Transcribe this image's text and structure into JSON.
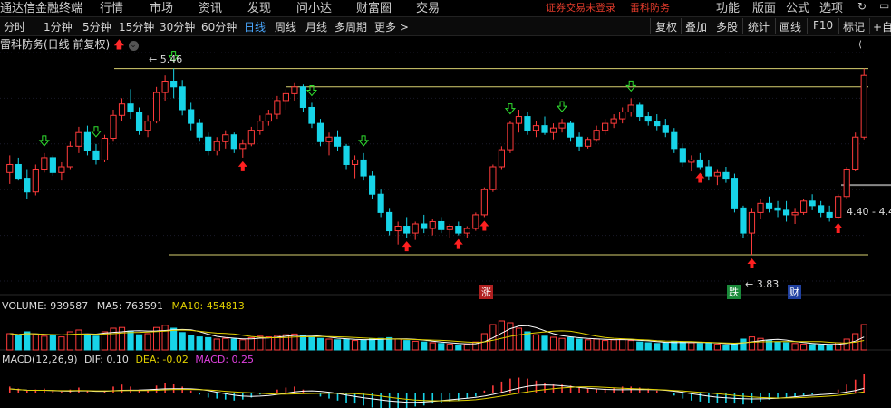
{
  "menubar": {
    "app_title": "通达信金融终端",
    "menus": [
      "行情",
      "市场",
      "资讯",
      "发现",
      "问小达",
      "财富圈",
      "交易"
    ],
    "alert": "证券交易未登录",
    "stock_link": "雷科防务",
    "right_menus": [
      "功能",
      "版面",
      "公式",
      "选项"
    ]
  },
  "timeframes": [
    "分时",
    "1分钟",
    "5分钟",
    "15分钟",
    "30分钟",
    "60分钟",
    "日线",
    "周线",
    "月线",
    "多周期",
    "更多 >"
  ],
  "active_timeframe": "日线",
  "tools": [
    "复权",
    "叠加",
    "多股",
    "统计",
    "画线",
    "F10",
    "标记",
    "+自"
  ],
  "chart_title": "雷科防务(日线 前复权)",
  "labels": {
    "high": "5.46",
    "low": "3.83",
    "range": "4.40 - 4.4",
    "zhang": "涨",
    "die": "跌",
    "cai": "财"
  },
  "volume": {
    "name": "VOLUME: 939587",
    "ma5": "MA5: 763591",
    "ma10": "MA10: 454813"
  },
  "macd": {
    "name": "MACD(12,26,9)",
    "dif": "DIF: 0.10",
    "dea": "DEA: -0.02",
    "macd": "MACD: 0.25"
  },
  "colors": {
    "up": "#ff3b3b",
    "down": "#17d4e8",
    "ma5": "#ffffff",
    "ma10": "#e0d000",
    "macd_text": "#e040e0",
    "active": "#4aa8ff"
  },
  "chart_data": [
    {
      "type": "candlestick",
      "title": "雷科防务(日线 前复权)",
      "price_range": [
        3.6,
        5.6
      ],
      "high": 5.46,
      "low": 3.83,
      "candles": [
        [
          4.55,
          4.7,
          4.45,
          4.62
        ],
        [
          4.62,
          4.68,
          4.48,
          4.5
        ],
        [
          4.5,
          4.58,
          4.32,
          4.38
        ],
        [
          4.38,
          4.62,
          4.35,
          4.58
        ],
        [
          4.58,
          4.72,
          4.55,
          4.68
        ],
        [
          4.68,
          4.7,
          4.52,
          4.55
        ],
        [
          4.55,
          4.64,
          4.48,
          4.6
        ],
        [
          4.6,
          4.82,
          4.58,
          4.78
        ],
        [
          4.78,
          4.95,
          4.72,
          4.9
        ],
        [
          4.9,
          4.96,
          4.7,
          4.74
        ],
        [
          4.74,
          4.8,
          4.62,
          4.66
        ],
        [
          4.66,
          4.88,
          4.64,
          4.85
        ],
        [
          4.85,
          5.1,
          4.82,
          5.05
        ],
        [
          5.05,
          5.2,
          5.0,
          5.15
        ],
        [
          5.15,
          5.28,
          5.02,
          5.08
        ],
        [
          5.08,
          5.12,
          4.88,
          4.92
        ],
        [
          4.92,
          5.05,
          4.86,
          5.0
        ],
        [
          5.0,
          5.3,
          4.98,
          5.25
        ],
        [
          5.25,
          5.4,
          5.18,
          5.35
        ],
        [
          5.35,
          5.46,
          5.2,
          5.3
        ],
        [
          5.3,
          5.36,
          5.05,
          5.1
        ],
        [
          5.1,
          5.16,
          4.92,
          4.98
        ],
        [
          4.98,
          5.02,
          4.82,
          4.86
        ],
        [
          4.86,
          4.9,
          4.7,
          4.74
        ],
        [
          4.74,
          4.86,
          4.7,
          4.82
        ],
        [
          4.82,
          4.92,
          4.76,
          4.88
        ],
        [
          4.88,
          4.9,
          4.72,
          4.76
        ],
        [
          4.76,
          4.84,
          4.68,
          4.8
        ],
        [
          4.8,
          4.95,
          4.78,
          4.92
        ],
        [
          4.92,
          5.05,
          4.88,
          5.0
        ],
        [
          5.0,
          5.1,
          4.96,
          5.06
        ],
        [
          5.06,
          5.22,
          5.02,
          5.18
        ],
        [
          5.18,
          5.28,
          5.1,
          5.24
        ],
        [
          5.24,
          5.34,
          5.18,
          5.3
        ],
        [
          5.3,
          5.32,
          5.08,
          5.12
        ],
        [
          5.12,
          5.16,
          4.94,
          4.98
        ],
        [
          4.98,
          5.02,
          4.78,
          4.82
        ],
        [
          4.82,
          4.9,
          4.7,
          4.86
        ],
        [
          4.86,
          4.92,
          4.74,
          4.78
        ],
        [
          4.78,
          4.8,
          4.58,
          4.62
        ],
        [
          4.62,
          4.7,
          4.5,
          4.66
        ],
        [
          4.66,
          4.72,
          4.48,
          4.52
        ],
        [
          4.52,
          4.56,
          4.32,
          4.36
        ],
        [
          4.36,
          4.4,
          4.16,
          4.2
        ],
        [
          4.2,
          4.24,
          4.0,
          4.04
        ],
        [
          4.04,
          4.12,
          3.92,
          4.08
        ],
        [
          4.08,
          4.16,
          3.98,
          4.02
        ],
        [
          4.02,
          4.12,
          3.96,
          4.1
        ],
        [
          4.1,
          4.18,
          4.02,
          4.06
        ],
        [
          4.06,
          4.14,
          4.0,
          4.12
        ],
        [
          4.12,
          4.16,
          4.02,
          4.05
        ],
        [
          4.05,
          4.1,
          3.98,
          4.08
        ],
        [
          4.08,
          4.12,
          4.0,
          4.02
        ],
        [
          4.02,
          4.08,
          3.98,
          4.06
        ],
        [
          4.06,
          4.2,
          4.04,
          4.18
        ],
        [
          4.18,
          4.42,
          4.16,
          4.4
        ],
        [
          4.4,
          4.62,
          4.38,
          4.6
        ],
        [
          4.6,
          4.78,
          4.58,
          4.75
        ],
        [
          4.75,
          5.0,
          4.72,
          4.98
        ],
        [
          4.98,
          5.1,
          4.9,
          5.04
        ],
        [
          5.04,
          5.08,
          4.88,
          4.92
        ],
        [
          4.92,
          5.0,
          4.86,
          4.96
        ],
        [
          4.96,
          5.04,
          4.88,
          4.9
        ],
        [
          4.9,
          4.98,
          4.84,
          4.94
        ],
        [
          4.94,
          5.02,
          4.9,
          4.98
        ],
        [
          4.98,
          5.0,
          4.82,
          4.86
        ],
        [
          4.86,
          4.9,
          4.74,
          4.78
        ],
        [
          4.78,
          4.86,
          4.76,
          4.84
        ],
        [
          4.84,
          4.96,
          4.82,
          4.92
        ],
        [
          4.92,
          5.02,
          4.88,
          4.98
        ],
        [
          4.98,
          5.06,
          4.94,
          5.02
        ],
        [
          5.02,
          5.12,
          4.98,
          5.08
        ],
        [
          5.08,
          5.2,
          5.04,
          5.14
        ],
        [
          5.14,
          5.16,
          5.0,
          5.04
        ],
        [
          5.04,
          5.08,
          4.96,
          5.0
        ],
        [
          5.0,
          5.06,
          4.92,
          4.96
        ],
        [
          4.96,
          5.02,
          4.86,
          4.9
        ],
        [
          4.9,
          4.94,
          4.72,
          4.76
        ],
        [
          4.76,
          4.8,
          4.6,
          4.64
        ],
        [
          4.64,
          4.7,
          4.56,
          4.66
        ],
        [
          4.66,
          4.72,
          4.58,
          4.6
        ],
        [
          4.6,
          4.66,
          4.48,
          4.52
        ],
        [
          4.52,
          4.58,
          4.44,
          4.55
        ],
        [
          4.55,
          4.6,
          4.46,
          4.5
        ],
        [
          4.5,
          4.54,
          4.2,
          4.24
        ],
        [
          4.24,
          4.26,
          3.98,
          4.02
        ],
        [
          4.02,
          4.24,
          3.83,
          4.2
        ],
        [
          4.2,
          4.32,
          4.14,
          4.28
        ],
        [
          4.28,
          4.34,
          4.2,
          4.24
        ],
        [
          4.24,
          4.3,
          4.16,
          4.22
        ],
        [
          4.22,
          4.3,
          4.12,
          4.18
        ],
        [
          4.18,
          4.24,
          4.1,
          4.2
        ],
        [
          4.2,
          4.32,
          4.18,
          4.3
        ],
        [
          4.3,
          4.36,
          4.22,
          4.26
        ],
        [
          4.26,
          4.3,
          4.16,
          4.2
        ],
        [
          4.2,
          4.26,
          4.12,
          4.16
        ],
        [
          4.16,
          4.36,
          4.14,
          4.34
        ],
        [
          4.34,
          4.6,
          4.32,
          4.58
        ],
        [
          4.58,
          4.9,
          4.56,
          4.86
        ],
        [
          4.86,
          5.46,
          4.84,
          5.4
        ]
      ],
      "volume_ratio": [
        0.45,
        0.4,
        0.5,
        0.42,
        0.38,
        0.4,
        0.36,
        0.5,
        0.55,
        0.4,
        0.38,
        0.5,
        0.6,
        0.62,
        0.52,
        0.42,
        0.45,
        0.62,
        0.68,
        0.6,
        0.48,
        0.4,
        0.36,
        0.34,
        0.3,
        0.32,
        0.3,
        0.28,
        0.34,
        0.38,
        0.36,
        0.4,
        0.42,
        0.44,
        0.38,
        0.35,
        0.32,
        0.3,
        0.28,
        0.3,
        0.26,
        0.28,
        0.3,
        0.32,
        0.34,
        0.3,
        0.26,
        0.24,
        0.22,
        0.2,
        0.18,
        0.16,
        0.14,
        0.16,
        0.22,
        0.45,
        0.7,
        0.8,
        0.75,
        0.6,
        0.5,
        0.42,
        0.38,
        0.35,
        0.32,
        0.34,
        0.3,
        0.28,
        0.3,
        0.26,
        0.28,
        0.3,
        0.26,
        0.22,
        0.2,
        0.18,
        0.2,
        0.24,
        0.22,
        0.2,
        0.18,
        0.2,
        0.16,
        0.14,
        0.16,
        0.3,
        0.36,
        0.32,
        0.26,
        0.22,
        0.2,
        0.18,
        0.16,
        0.15,
        0.14,
        0.14,
        0.2,
        0.3,
        0.45,
        0.7
      ],
      "macd_hist": [
        0.3,
        0.2,
        0.1,
        0.15,
        0.2,
        0.1,
        0.05,
        0.15,
        0.25,
        0.1,
        0.0,
        0.1,
        0.3,
        0.4,
        0.3,
        0.15,
        0.15,
        0.35,
        0.5,
        0.45,
        0.3,
        0.1,
        -0.1,
        -0.25,
        -0.3,
        -0.35,
        -0.4,
        -0.35,
        -0.25,
        -0.1,
        0.0,
        0.15,
        0.25,
        0.3,
        0.15,
        0.0,
        -0.2,
        -0.3,
        -0.4,
        -0.5,
        -0.55,
        -0.65,
        -0.75,
        -0.85,
        -0.9,
        -0.85,
        -0.8,
        -0.7,
        -0.65,
        -0.55,
        -0.5,
        -0.45,
        -0.4,
        -0.3,
        -0.2,
        0.1,
        0.35,
        0.55,
        0.7,
        0.75,
        0.7,
        0.6,
        0.5,
        0.45,
        0.4,
        0.35,
        0.25,
        0.2,
        0.2,
        0.2,
        0.25,
        0.3,
        0.3,
        0.25,
        0.2,
        0.1,
        0.0,
        -0.15,
        -0.3,
        -0.4,
        -0.45,
        -0.5,
        -0.5,
        -0.5,
        -0.55,
        -0.6,
        -0.55,
        -0.45,
        -0.35,
        -0.3,
        -0.25,
        -0.2,
        -0.15,
        -0.1,
        -0.05,
        0.0,
        0.15,
        0.4,
        0.65,
        0.95
      ]
    }
  ]
}
